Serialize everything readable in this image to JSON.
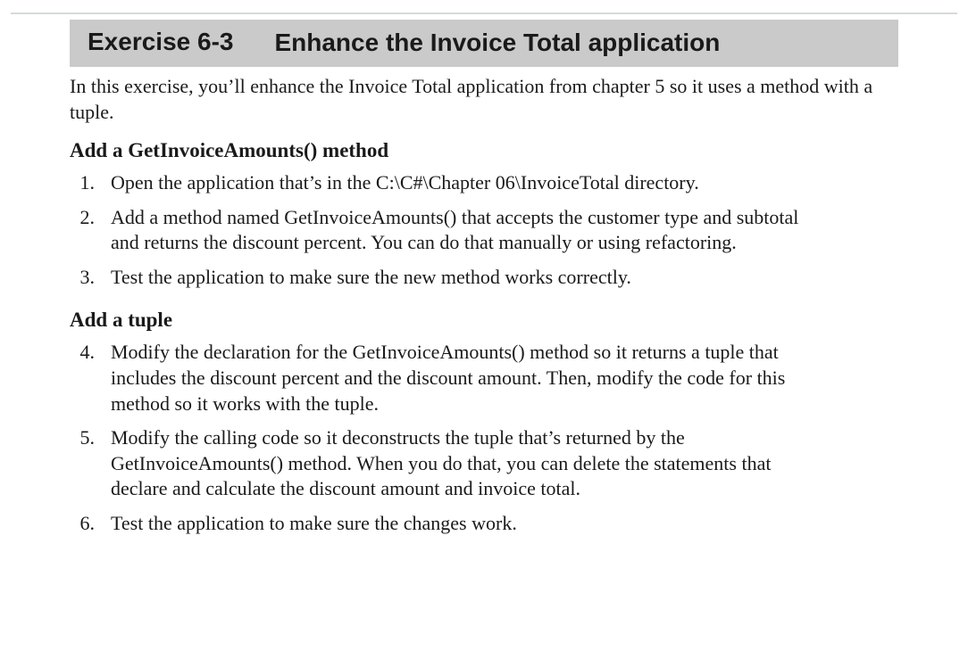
{
  "header": {
    "exercise_label": "Exercise 6-3",
    "title": "Enhance the Invoice Total application"
  },
  "intro": "In this exercise, you’ll enhance the Invoice Total application from chapter 5 so it uses a method with a tuple.",
  "sections": [
    {
      "heading": "Add a GetInvoiceAmounts() method",
      "items": [
        {
          "num": "1.",
          "text": "Open the application that’s in the C:\\C#\\Chapter 06\\InvoiceTotal directory."
        },
        {
          "num": "2.",
          "text": "Add a method named GetInvoiceAmounts() that accepts the customer type and subtotal and returns the discount percent. You can do that manually or using refactoring."
        },
        {
          "num": "3.",
          "text": "Test the application to make sure the new method works correctly."
        }
      ]
    },
    {
      "heading": "Add a tuple",
      "items": [
        {
          "num": "4.",
          "text": "Modify the declaration for the GetInvoiceAmounts() method so it returns a tuple that includes the discount percent and the discount amount. Then, modify the code for this method so it works with the tuple."
        },
        {
          "num": "5.",
          "text": "Modify the calling code so it deconstructs the tuple that’s returned by the GetInvoiceAmounts() method. When you do that, you can delete the statements that declare and calculate the discount amount and invoice total."
        },
        {
          "num": "6.",
          "text": "Test the application to make sure the changes work."
        }
      ]
    }
  ]
}
